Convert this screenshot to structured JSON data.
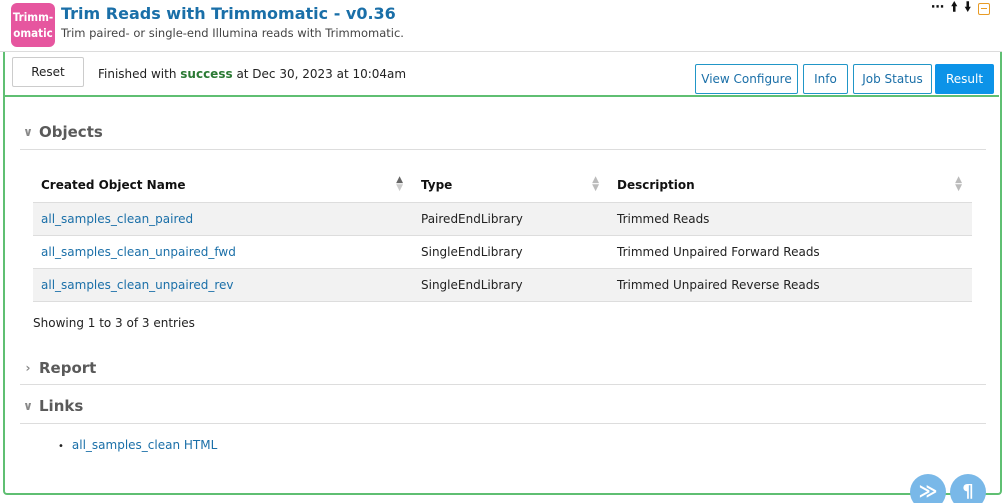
{
  "header": {
    "logo_line1": "Trimm-",
    "logo_line2": "omatic",
    "title": "Trim Reads with Trimmomatic - v0.36",
    "subtitle": "Trim paired- or single-end Illumina reads with Trimmomatic.",
    "controls": {
      "more_icon": "ellipsis-icon",
      "up_icon": "arrow-up-icon",
      "down_icon": "arrow-down-icon",
      "collapse_icon": "collapse-icon"
    }
  },
  "toolbar": {
    "reset_label": "Reset",
    "status_prefix": "Finished with",
    "status_word": "success",
    "status_suffix": "at Dec 30, 2023 at 10:04am",
    "tabs": [
      {
        "label": "View Configure"
      },
      {
        "label": "Info"
      },
      {
        "label": "Job Status"
      },
      {
        "label": "Result"
      }
    ]
  },
  "sections": {
    "objects": {
      "title": "Objects",
      "columns": [
        "Created Object Name",
        "Type",
        "Description"
      ],
      "rows": [
        {
          "name": "all_samples_clean_paired",
          "type": "PairedEndLibrary",
          "description": "Trimmed Reads"
        },
        {
          "name": "all_samples_clean_unpaired_fwd",
          "type": "SingleEndLibrary",
          "description": "Trimmed Unpaired Forward Reads"
        },
        {
          "name": "all_samples_clean_unpaired_rev",
          "type": "SingleEndLibrary",
          "description": "Trimmed Unpaired Reverse Reads"
        }
      ],
      "entries_info": "Showing 1 to 3 of 3 entries"
    },
    "report": {
      "title": "Report"
    },
    "links": {
      "title": "Links",
      "items": [
        "all_samples_clean HTML"
      ]
    }
  },
  "colors": {
    "accent": "#0c93e8",
    "success": "#2b7a34",
    "cell_border": "#5fbf72",
    "logo_bg": "#e6569f"
  }
}
